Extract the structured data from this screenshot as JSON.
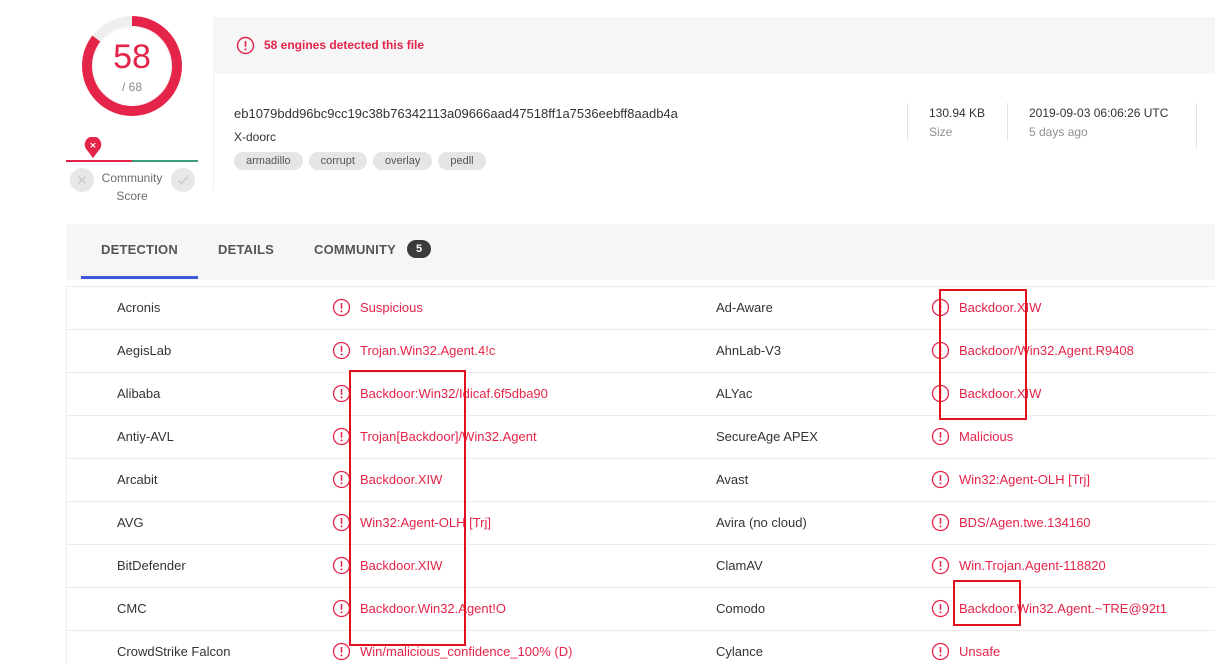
{
  "score": {
    "detected": "58",
    "total": "/ 68",
    "detected_count": 58,
    "total_count": 68,
    "color": "#e5244a"
  },
  "community_score": {
    "label_line1": "Community",
    "label_line2": "Score"
  },
  "header": {
    "detection_message": "58 engines detected this file",
    "hash": "eb1079bdd96bc9cc19c38b76342113a09666aad47518ff1a7536eebff8aadb4a",
    "file_name": "X-doorc",
    "tags": [
      "armadillo",
      "corrupt",
      "overlay",
      "pedll"
    ],
    "size_value": "130.94 KB",
    "size_label": "Size",
    "date_value": "2019-09-03 06:06:26 UTC",
    "date_label": "5 days ago"
  },
  "tabs": {
    "detection": "DETECTION",
    "details": "DETAILS",
    "community": "COMMUNITY",
    "community_count": "5",
    "accent": "#3c57d8"
  },
  "detections": [
    {
      "left_engine": "Acronis",
      "left_result": "Suspicious",
      "right_engine": "Ad-Aware",
      "right_result": "Backdoor.XIW"
    },
    {
      "left_engine": "AegisLab",
      "left_result": "Trojan.Win32.Agent.4!c",
      "right_engine": "AhnLab-V3",
      "right_result": "Backdoor/Win32.Agent.R9408"
    },
    {
      "left_engine": "Alibaba",
      "left_result": "Backdoor:Win32/Idicaf.6f5dba90",
      "right_engine": "ALYac",
      "right_result": "Backdoor.XIW"
    },
    {
      "left_engine": "Antiy-AVL",
      "left_result": "Trojan[Backdoor]/Win32.Agent",
      "right_engine": "SecureAge APEX",
      "right_result": "Malicious"
    },
    {
      "left_engine": "Arcabit",
      "left_result": "Backdoor.XIW",
      "right_engine": "Avast",
      "right_result": "Win32:Agent-OLH [Trj]"
    },
    {
      "left_engine": "AVG",
      "left_result": "Win32:Agent-OLH [Trj]",
      "right_engine": "Avira (no cloud)",
      "right_result": "BDS/Agen.twe.134160"
    },
    {
      "left_engine": "BitDefender",
      "left_result": "Backdoor.XIW",
      "right_engine": "ClamAV",
      "right_result": "Win.Trojan.Agent-118820"
    },
    {
      "left_engine": "CMC",
      "left_result": "Backdoor.Win32.Agent!O",
      "right_engine": "Comodo",
      "right_result": "Backdoor.Win32.Agent.~TRE@92t1"
    },
    {
      "left_engine": "CrowdStrike Falcon",
      "left_result": "Win/malicious_confidence_100% (D)",
      "right_engine": "Cylance",
      "right_result": "Unsafe"
    }
  ],
  "icons": {
    "alert": "alert-circle-icon",
    "close": "close-icon",
    "check": "check-icon"
  },
  "annotation_color": "#e0101f"
}
